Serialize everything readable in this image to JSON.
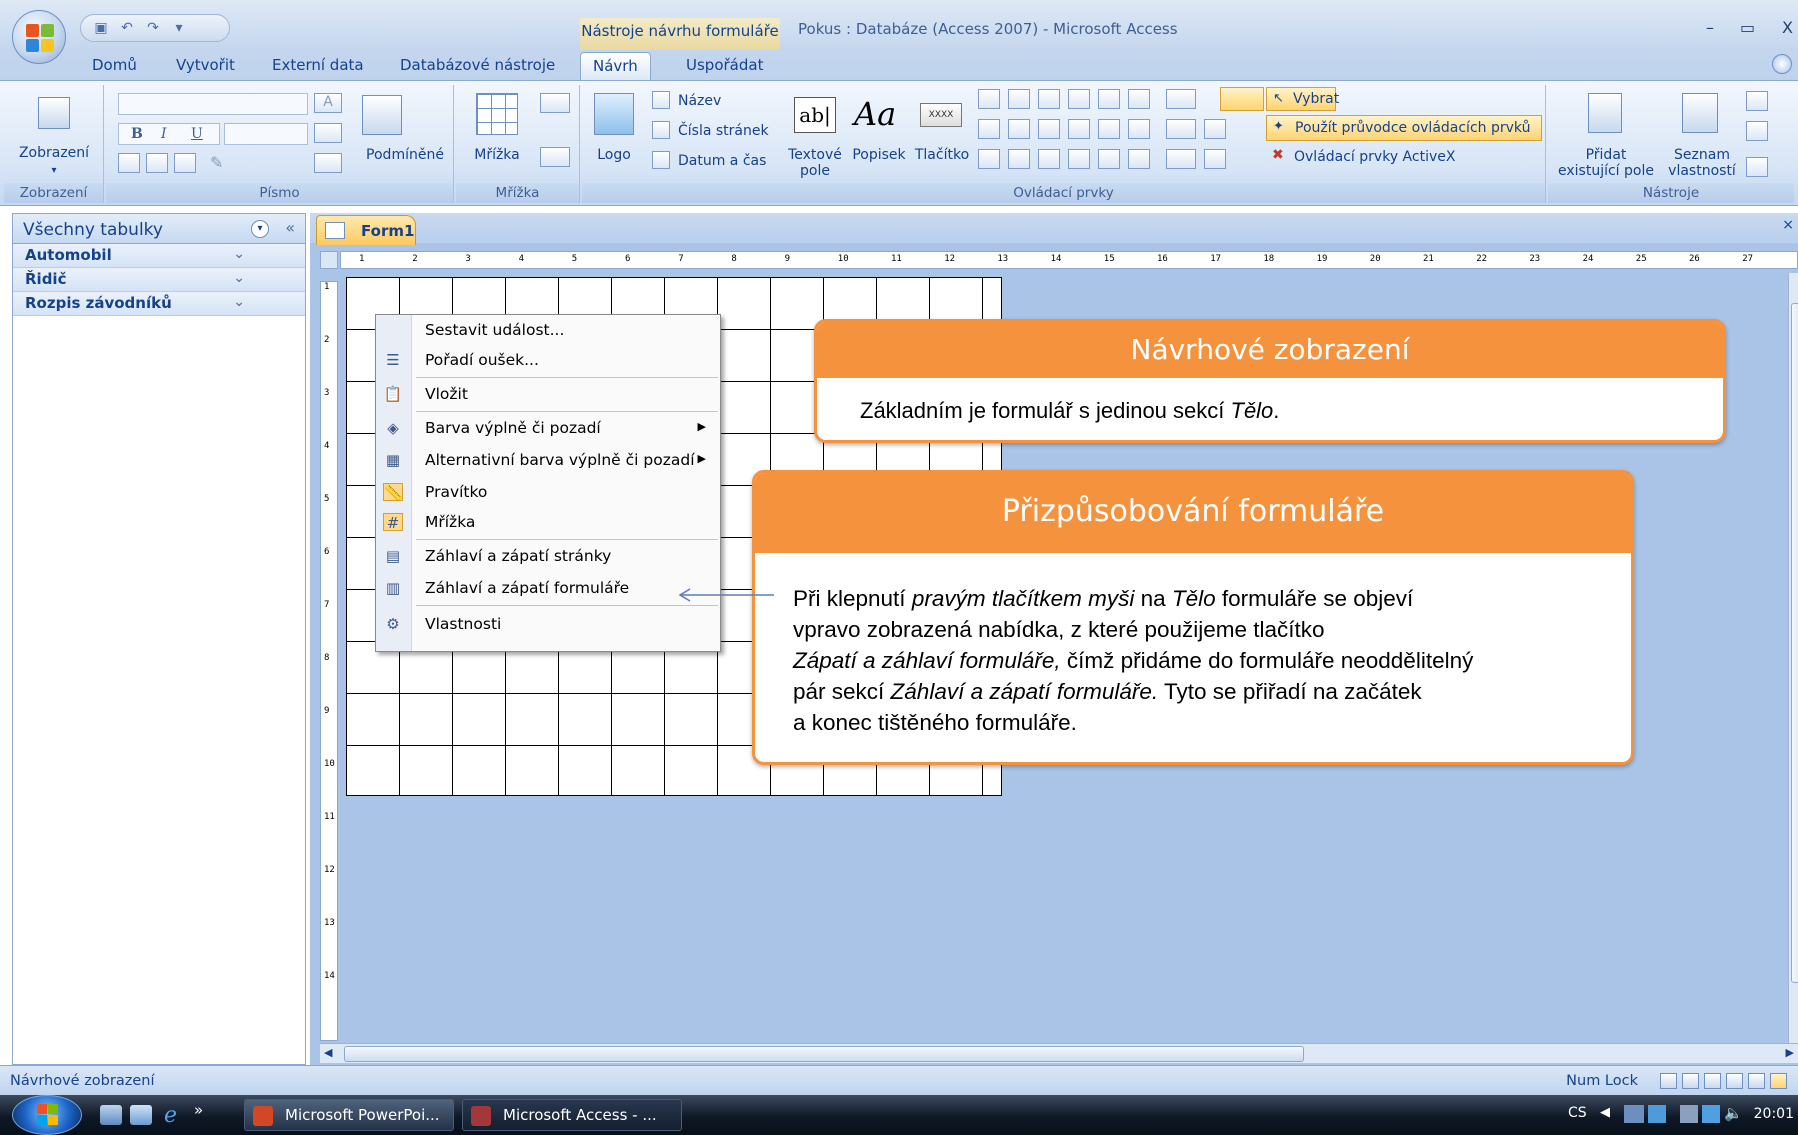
{
  "titlebar": {
    "context_tab_title": "Nástroje návrhu formuláře",
    "window_title": "Pokus : Databáze (Access 2007) - Microsoft Access",
    "minimize": "–",
    "restore": "▭",
    "close": "X"
  },
  "tabs": [
    "Domů",
    "Vytvořit",
    "Externí data",
    "Databázové nástroje",
    "Návrh",
    "Uspořádat"
  ],
  "ribbon": {
    "view_group": {
      "button": "Zobrazení",
      "label": "Zobrazení"
    },
    "font_group": {
      "label": "Písmo",
      "conditional": "Podmíněné"
    },
    "grid_group": {
      "button": "Mřížka",
      "label": "Mřížka"
    },
    "controls_group": {
      "logo": "Logo",
      "title": "Název",
      "page_numbers": "Čísla stránek",
      "date_time": "Datum a čas",
      "textbox": "Textové pole",
      "textbox_line1": "Textové",
      "textbox_line2": "pole",
      "label_btn": "Popisek",
      "button_btn": "Tlačítko",
      "select": "Vybrat",
      "use_wizards": "Použít průvodce ovládacích prvků",
      "activex": "Ovládací prvky ActiveX",
      "label": "Ovládací prvky",
      "textbox_glyph": "ab|",
      "label_glyph": "Aa",
      "button_glyph": "XXXX"
    },
    "tools_group": {
      "add_existing": "Přidat existující pole",
      "add_line1": "Přidat",
      "add_line2": "existující pole",
      "property_sheet": "Seznam vlastností",
      "prop_line1": "Seznam",
      "prop_line2": "vlastností",
      "label": "Nástroje"
    }
  },
  "navpane": {
    "title": "Všechny tabulky",
    "items": [
      "Automobil",
      "Řidič",
      "Rozpis závodníků"
    ]
  },
  "document": {
    "tab_label": "Form1",
    "ruler_top": [
      "1",
      "2",
      "3",
      "4",
      "5",
      "6",
      "7",
      "8",
      "9",
      "10",
      "11",
      "12",
      "13",
      "14",
      "15",
      "16",
      "17",
      "18",
      "19",
      "20",
      "21",
      "22",
      "23",
      "24",
      "25",
      "26",
      "27"
    ],
    "ruler_left": [
      "1",
      "2",
      "3",
      "4",
      "5",
      "6",
      "7",
      "8",
      "9",
      "10",
      "11",
      "12",
      "13",
      "14"
    ]
  },
  "context_menu": {
    "items": [
      {
        "label": "Sestavit událost...",
        "icon": "",
        "submenu": false
      },
      {
        "label": "Pořadí oušek...",
        "icon": "tab-order-icon",
        "submenu": false
      },
      {
        "label": "Vložit",
        "icon": "paste-icon",
        "submenu": false
      },
      {
        "label": "Barva výplně či pozadí",
        "icon": "fill-color-icon",
        "submenu": true
      },
      {
        "label": "Alternativní barva výplně či pozadí",
        "icon": "alt-fill-icon",
        "submenu": true
      },
      {
        "label": "Pravítko",
        "icon": "ruler-icon",
        "submenu": false
      },
      {
        "label": "Mřížka",
        "icon": "grid-icon",
        "submenu": false
      },
      {
        "label": "Záhlaví a zápatí stránky",
        "icon": "page-header-icon",
        "submenu": false
      },
      {
        "label": "Záhlaví a zápatí formuláře",
        "icon": "form-header-icon",
        "submenu": false
      },
      {
        "label": "Vlastnosti",
        "icon": "properties-icon",
        "submenu": false
      }
    ]
  },
  "callouts": {
    "design_view": {
      "title": "Návrhové zobrazení",
      "body_a": "Základním je formulář s jedinou sekcí ",
      "body_em": "Tělo",
      "body_b": "."
    },
    "customizing": {
      "title": "Přizpůsobování formuláře",
      "l1a": "Při klepnutí ",
      "l1em": "pravým tlačítkem myši",
      "l1b": " na ",
      "l1em2": "Tělo",
      "l1c": " formuláře se objeví",
      "l2": "vpravo zobrazená nabídka, z které použijeme tlačítko",
      "l3em": "Zápatí a záhlaví formuláře,",
      "l3b": " čímž přidáme do formuláře neoddělitelný",
      "l4a": "pár sekcí ",
      "l4em": "Záhlaví a zápatí formuláře.",
      "l4b": " Tyto se přiřadí na začátek",
      "l5": "a konec tištěného formuláře."
    }
  },
  "statusbar": {
    "text": "Návrhové zobrazení",
    "numlock": "Num Lock"
  },
  "taskbar": {
    "tasks": [
      "Microsoft PowerPoi...",
      "Microsoft Access - ..."
    ],
    "chevron": "»",
    "language": "CS",
    "time": "20:01"
  },
  "colors": {
    "accent_orange": "#f5923e",
    "ribbon_blue": "#c4d6ee",
    "text_blue": "#15428b"
  }
}
